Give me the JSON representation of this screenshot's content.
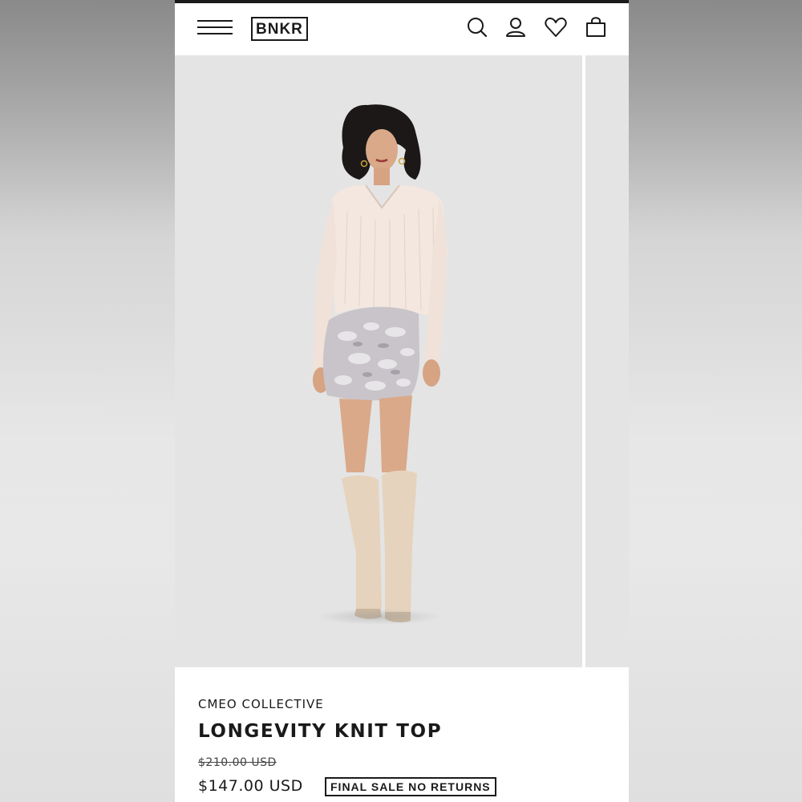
{
  "header": {
    "logo_text": "BNKR",
    "icons": [
      "menu-icon",
      "search-icon",
      "account-icon",
      "wishlist-icon",
      "bag-icon"
    ]
  },
  "gallery": {
    "image_description_icon": "product-photo"
  },
  "product": {
    "brand": "CMEO COLLECTIVE",
    "title": "LONGEVITY KNIT TOP",
    "original_price": "$210.00 USD",
    "sale_price": "$147.00 USD",
    "badge": "FINAL SALE NO RETURNS"
  },
  "colors": {
    "text": "#1a1a1a",
    "image_background": "#e4e4e4",
    "sweater": "#f3e7df",
    "boots": "#e6d3bd"
  }
}
